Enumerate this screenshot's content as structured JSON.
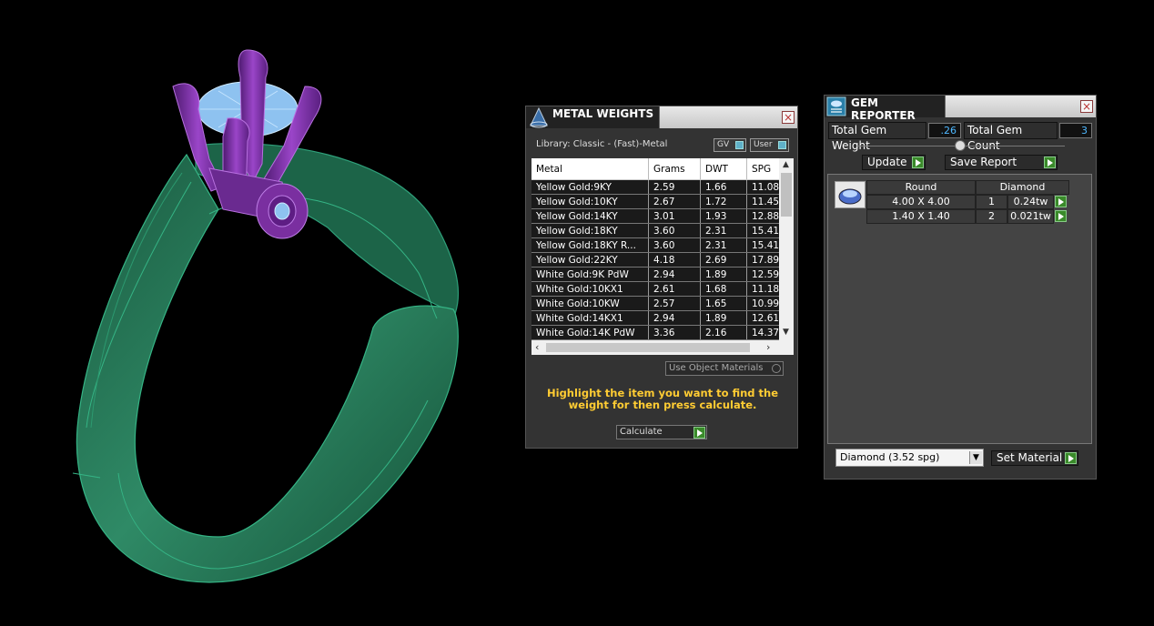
{
  "metal_weights": {
    "title": "METAL WEIGHTS",
    "library": "Library: Classic - (Fast)-Metal",
    "toggle_gv": "GV",
    "toggle_user": "User",
    "columns": [
      "Metal",
      "Grams",
      "DWT",
      "SPG"
    ],
    "rows": [
      [
        "Yellow Gold:9KY",
        "2.59",
        "1.66",
        "11.08"
      ],
      [
        "Yellow Gold:10KY",
        "2.67",
        "1.72",
        "11.45"
      ],
      [
        "Yellow Gold:14KY",
        "3.01",
        "1.93",
        "12.88"
      ],
      [
        "Yellow Gold:18KY",
        "3.60",
        "2.31",
        "15.41"
      ],
      [
        "Yellow Gold:18KY R...",
        "3.60",
        "2.31",
        "15.41"
      ],
      [
        "Yellow Gold:22KY",
        "4.18",
        "2.69",
        "17.89"
      ],
      [
        "White Gold:9K PdW",
        "2.94",
        "1.89",
        "12.59"
      ],
      [
        "White Gold:10KX1",
        "2.61",
        "1.68",
        "11.18"
      ],
      [
        "White Gold:10KW",
        "2.57",
        "1.65",
        "10.99"
      ],
      [
        "White Gold:14KX1",
        "2.94",
        "1.89",
        "12.61"
      ],
      [
        "White Gold:14K PdW",
        "3.36",
        "2.16",
        "14.37"
      ]
    ],
    "use_object_materials": "Use Object Materials",
    "message": "Highlight the item you want to find the weight for then press calculate.",
    "calculate_label": "Calculate"
  },
  "gem_reporter": {
    "title": "GEM REPORTER",
    "total_weight_label": "Total Gem Weight",
    "total_weight_value": ".26",
    "total_count_label": "Total Gem Count",
    "total_count_value": "3",
    "update_label": "Update",
    "save_report_label": "Save Report",
    "shape_header": "Round",
    "material_header": "Diamond",
    "gems": [
      {
        "size": "4.00 X 4.00",
        "count": "1",
        "weight": "0.24tw"
      },
      {
        "size": "1.40 X 1.40",
        "count": "2",
        "weight": "0.021tw"
      }
    ],
    "material_select": "Diamond     (3.52 spg)",
    "set_material_label": "Set Material"
  },
  "colors": {
    "ring_metal": "#1f6b4e",
    "prongs": "#7a2fa0",
    "gem": "#8ec2f0",
    "accent_green": "#3a8a2a",
    "message_yellow": "#ffcc33"
  }
}
